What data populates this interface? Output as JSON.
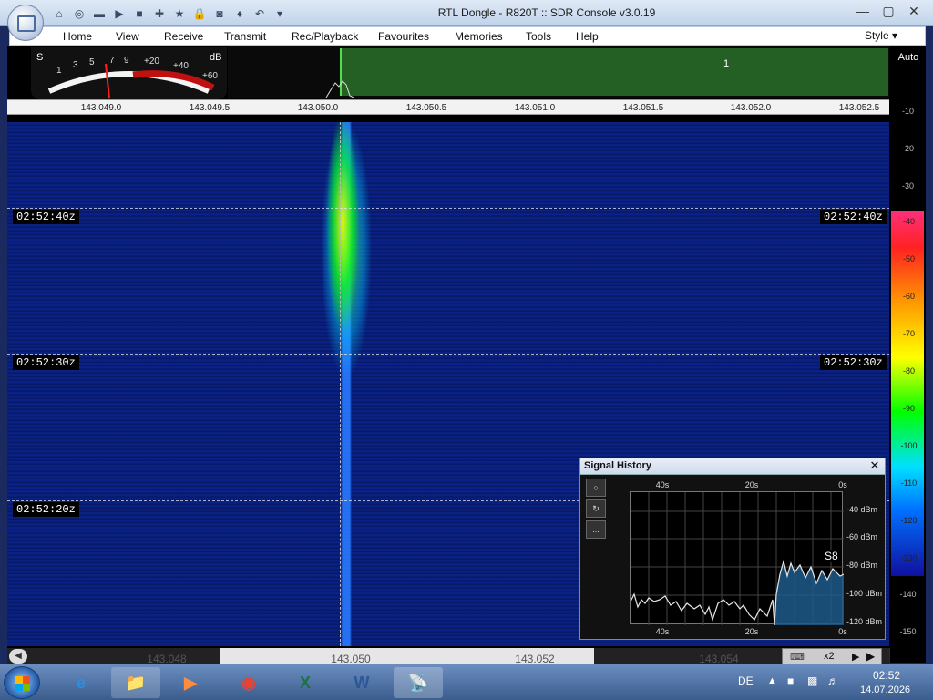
{
  "window": {
    "title": "RTL Dongle - R820T :: SDR Console v3.0.19"
  },
  "quick_access": [
    {
      "icon": "home-icon"
    },
    {
      "icon": "lifebuoy-icon"
    },
    {
      "icon": "folder-icon"
    },
    {
      "icon": "play-icon"
    },
    {
      "icon": "stop-icon"
    },
    {
      "icon": "plus-icon"
    },
    {
      "icon": "star-icon"
    },
    {
      "icon": "lock-icon"
    },
    {
      "icon": "camera-icon"
    },
    {
      "icon": "drop-icon"
    },
    {
      "icon": "undo-icon"
    },
    {
      "icon": "dropdown-icon"
    }
  ],
  "menu": {
    "items": [
      "Home",
      "View",
      "Receive",
      "Transmit",
      "Rec/Playback",
      "Favourites",
      "Memories",
      "Tools",
      "Help"
    ],
    "style_label": "Style"
  },
  "smeter": {
    "unit_s": "S",
    "unit_db": "dB",
    "s_labels": [
      "1",
      "3",
      "5",
      "7",
      "9"
    ],
    "db_labels": [
      "+20",
      "+40",
      "+60"
    ],
    "needle_level": "S7"
  },
  "spectrum": {
    "filter_label": "1",
    "freq_ticks": [
      "143.049.0",
      "143.049.5",
      "143.050.0",
      "143.050.5",
      "143.051.0",
      "143.051.5",
      "143.052.0",
      "143.052.5"
    ]
  },
  "waterfall": {
    "time_markers": [
      "02:52:40z",
      "02:52:30z",
      "02:52:20z"
    ],
    "signal_freq_label": "143.050.0"
  },
  "db_scale": {
    "auto_label": "Auto",
    "upper_ticks": [
      "-10",
      "-20",
      "-30"
    ],
    "color_ticks": [
      "-40",
      "-50",
      "-60",
      "-70",
      "-80",
      "-90",
      "-100",
      "-110",
      "-120",
      "-130"
    ],
    "lower_ticks": [
      "-140",
      "-150"
    ]
  },
  "bottom_ruler": {
    "ticks": [
      "143.048",
      "143.050",
      "143.052",
      "143.054"
    ],
    "zoom_label": "x2"
  },
  "signal_history": {
    "title": "Signal History",
    "buttons": [
      "○",
      "↻",
      "..."
    ],
    "x_top": [
      "40s",
      "20s",
      "0s"
    ],
    "x_bottom": [
      "40s",
      "20s",
      "0s"
    ],
    "y_labels": [
      "-40 dBm",
      "-60 dBm",
      "-80 dBm",
      "-100 dBm",
      "-120 dBm"
    ],
    "s_reading": "S8"
  },
  "taskbar": {
    "apps": [
      {
        "name": "internet-explorer",
        "label": "e"
      },
      {
        "name": "file-explorer",
        "label": "📁"
      },
      {
        "name": "media-player",
        "label": "▶"
      },
      {
        "name": "chrome",
        "label": "◉"
      },
      {
        "name": "excel",
        "label": "X"
      },
      {
        "name": "word",
        "label": "W"
      },
      {
        "name": "sdr-console",
        "label": "📡"
      }
    ],
    "language": "DE",
    "time": "02:52",
    "date": "14.07.2026"
  },
  "colors": {
    "waterfall_bg": "#0a1f7a",
    "signal_core": "#00ff00",
    "signal_hot": "#ffff00",
    "filter_band": "#3aa83a"
  }
}
